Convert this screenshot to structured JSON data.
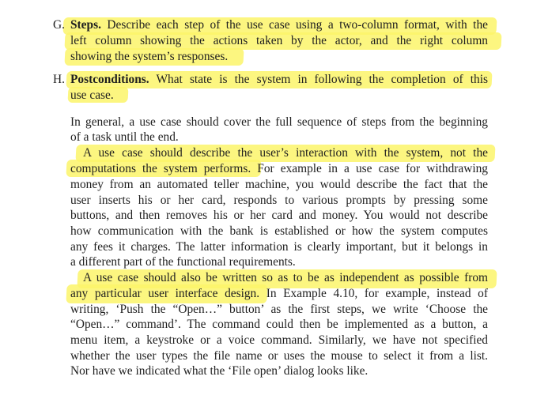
{
  "items": [
    {
      "letter": "G.",
      "heading": "Steps.",
      "lines": [
        " Describe each step of the use case using a two-column format, with the",
        "left column showing the actions taken by the actor, and the right column",
        "showing the system’s responses."
      ]
    },
    {
      "letter": "H.",
      "heading": "Postconditions.",
      "lines": [
        " What state is the system in following the completion of this",
        "use case."
      ]
    }
  ],
  "paragraphs": [
    {
      "lines": [
        "In general, a use case should cover the full sequence of steps from the beginning",
        "of a task until the end."
      ]
    },
    {
      "lines": [
        "A use case should describe the user’s interaction with the system, not the",
        "computations the system performs. For example in a use case for withdrawing",
        "money from an automated teller machine, you would describe the fact that the",
        "user inserts his or her card, responds to various prompts by pressing some",
        "buttons, and then removes his or her card and money. You would not describe",
        "how communication with the bank is established or how the system computes",
        "any fees it charges. The latter information is clearly important, but it belongs in",
        "a different part of the functional requirements."
      ]
    },
    {
      "lines": [
        "A use case should also be written so as to be as independent as possible from",
        "any particular user interface design. In Example 4.10, for example, instead of",
        "writing, ‘Push the “Open…” button’ as the first steps, we write ‘Choose the",
        "“Open…” command’. The command could then be implemented as a button, a",
        "menu item, a keystroke or a voice command. Similarly, we have not specified",
        "whether the user types the file name or uses the mouse to select it from a list.",
        "Nor have we indicated what the ‘File open’ dialog looks like."
      ]
    }
  ],
  "highlight_color": "#fbf56a"
}
